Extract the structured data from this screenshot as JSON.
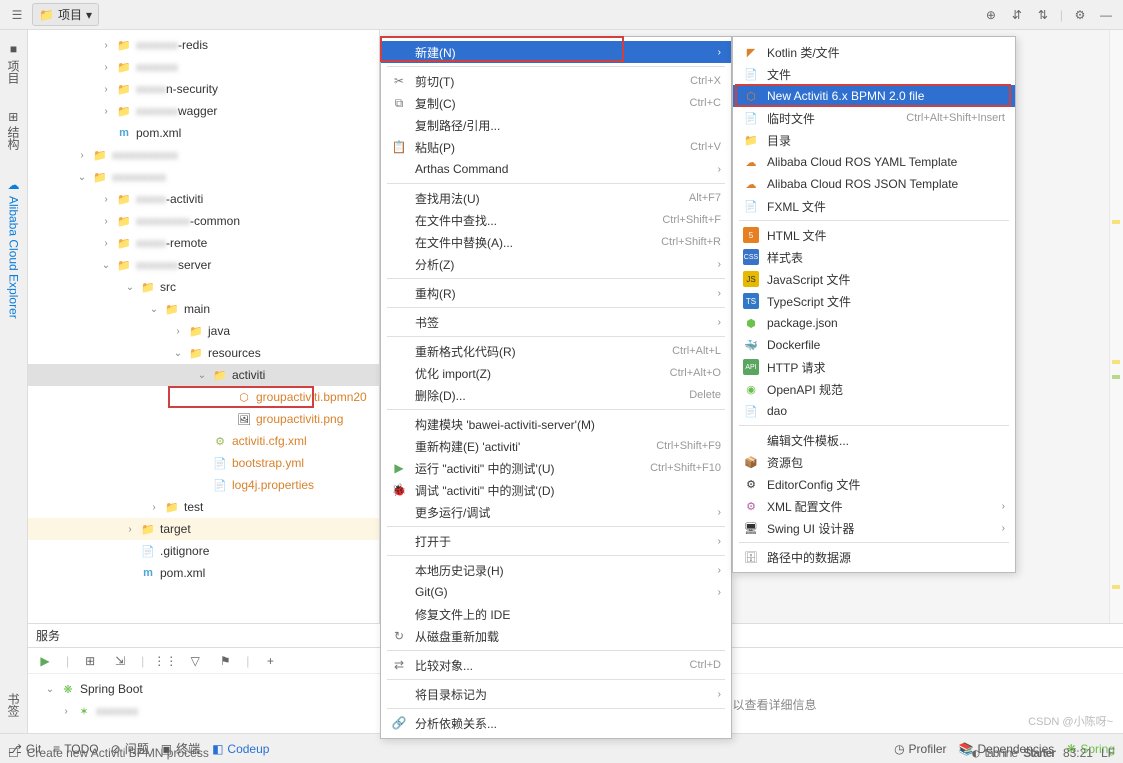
{
  "toolbar": {
    "project_label": "项目",
    "dropdown_arrow": "▾"
  },
  "sidebar": {
    "tab_project": "项目",
    "tab_structure": "结构",
    "tab_alibaba": "Alibaba Cloud Explorer",
    "tab_bookmarks": "书签"
  },
  "tree": {
    "redis": "-redis",
    "security": "n-security",
    "swagger": "wagger",
    "pom1": "pom.xml",
    "activiti": "-activiti",
    "common": "-common",
    "remote": "-remote",
    "server": "server",
    "src": "src",
    "main": "main",
    "java": "java",
    "resources": "resources",
    "activiti_folder": "activiti",
    "file1": "groupactiviti.bpmn20",
    "file2": "groupactiviti.png",
    "file3": "activiti.cfg.xml",
    "file4": "bootstrap.yml",
    "file5": "log4j.properties",
    "test": "test",
    "target": "target",
    "gitignore": ".gitignore",
    "pom2": "pom.xml"
  },
  "context_menu": {
    "new": "新建(N)",
    "cut": "剪切(T)",
    "cut_sc": "Ctrl+X",
    "copy": "复制(C)",
    "copy_sc": "Ctrl+C",
    "copy_path": "复制路径/引用...",
    "paste": "粘贴(P)",
    "paste_sc": "Ctrl+V",
    "arthas": "Arthas Command",
    "find_usages": "查找用法(U)",
    "find_usages_sc": "Alt+F7",
    "find_in_files": "在文件中查找...",
    "find_in_files_sc": "Ctrl+Shift+F",
    "replace_in_files": "在文件中替换(A)...",
    "replace_in_files_sc": "Ctrl+Shift+R",
    "analyze": "分析(Z)",
    "refactor": "重构(R)",
    "bookmarks": "书签",
    "reformat": "重新格式化代码(R)",
    "reformat_sc": "Ctrl+Alt+L",
    "optimize": "优化 import(Z)",
    "optimize_sc": "Ctrl+Alt+O",
    "delete": "删除(D)...",
    "delete_sc": "Delete",
    "build_module": "构建模块 'bawei-activiti-server'(M)",
    "rebuild": "重新构建(E) 'activiti'",
    "rebuild_sc": "Ctrl+Shift+F9",
    "run": "运行 \"activiti\" 中的测试'(U)",
    "run_sc": "Ctrl+Shift+F10",
    "debug": "调试 \"activiti\" 中的测试'(D)",
    "more_run": "更多运行/调试",
    "open_in": "打开于",
    "local_history": "本地历史记录(H)",
    "git": "Git(G)",
    "repair_ide": "修复文件上的 IDE",
    "reload_disk": "从磁盘重新加载",
    "compare": "比较对象...",
    "compare_sc": "Ctrl+D",
    "mark_dir": "将目录标记为",
    "analyze_deps": "分析依赖关系..."
  },
  "submenu": {
    "kotlin": "Kotlin 类/文件",
    "file": "文件",
    "new_activiti": "New Activiti 6.x BPMN 2.0 file",
    "scratch": "临时文件",
    "scratch_sc": "Ctrl+Alt+Shift+Insert",
    "directory": "目录",
    "ros_yaml": "Alibaba Cloud ROS YAML Template",
    "ros_json": "Alibaba Cloud ROS JSON Template",
    "fxml": "FXML 文件",
    "html": "HTML 文件",
    "stylesheet": "样式表",
    "js": "JavaScript 文件",
    "ts": "TypeScript 文件",
    "package_json": "package.json",
    "dockerfile": "Dockerfile",
    "http": "HTTP 请求",
    "openapi": "OpenAPI 规范",
    "dao": "dao",
    "edit_templates": "编辑文件模板...",
    "resource_bundle": "资源包",
    "editorconfig": "EditorConfig 文件",
    "xml_config": "XML 配置文件",
    "swing": "Swing UI 设计器",
    "datasource": "路径中的数据源"
  },
  "services": {
    "title": "服务",
    "spring_boot": "Spring Boot",
    "info": "选择服务以查看详细信息"
  },
  "statusbar": {
    "git": "Git",
    "todo": "TODO",
    "problems": "问题",
    "terminal": "终端",
    "codeup": "Codeup",
    "profiler": "Profiler",
    "dependencies": "Dependencies",
    "spring": "Spring",
    "message": "Create new Activiti BPMN process",
    "tabnine": "tabnine",
    "starter": "Starter",
    "pos": "83:21",
    "lf": "LF"
  },
  "watermark": "CSDN @小陈呀~"
}
